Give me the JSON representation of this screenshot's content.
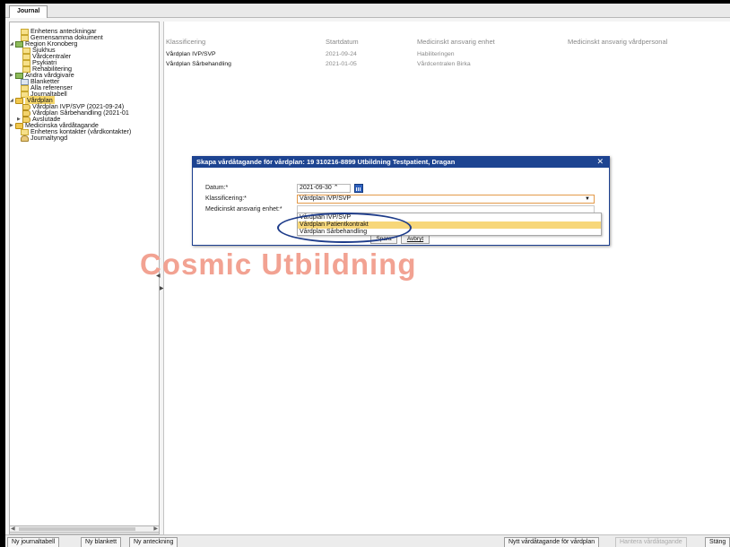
{
  "tabs": {
    "journal": "Journal"
  },
  "tree": [
    {
      "label": "Enhetens anteckningar",
      "icon": "document-icon"
    },
    {
      "label": "Gemensamma dokument",
      "icon": "document-icon"
    },
    {
      "label": "Region Kronoberg",
      "icon": "organization-icon"
    },
    {
      "label": "Sjukhus",
      "icon": "document-icon"
    },
    {
      "label": "Vårdcentraler",
      "icon": "document-icon"
    },
    {
      "label": "Psykiatri",
      "icon": "document-icon"
    },
    {
      "label": "Rehabilitering",
      "icon": "document-icon"
    },
    {
      "label": "Andra vårdgivare",
      "icon": "organization-icon"
    },
    {
      "label": "Blanketter",
      "icon": "table-icon"
    },
    {
      "label": "Alla referenser",
      "icon": "document-icon"
    },
    {
      "label": "Journaltabell",
      "icon": "document-icon"
    },
    {
      "label": "Vårdplan",
      "icon": "folder-icon"
    },
    {
      "label": "Vårdplan IVP/SVP (2021-09-24)",
      "icon": "care-plan-icon"
    },
    {
      "label": "Vårdplan Sårbehandling (2021-01",
      "icon": "care-plan-icon"
    },
    {
      "label": "Avslutade",
      "icon": "care-plan-icon"
    },
    {
      "label": "Medicinska vårdåtagande",
      "icon": "folder-icon"
    },
    {
      "label": "Enhetens kontakter (vårdkontakter)",
      "icon": "document-icon"
    },
    {
      "label": "Journaltyngd",
      "icon": "person-icon"
    }
  ],
  "grid": {
    "headers": [
      "Klassificering",
      "Startdatum",
      "Medicinskt ansvarig enhet",
      "Medicinskt ansvarig vårdpersonal"
    ],
    "rows": [
      [
        "Vårdplan IVP/SVP",
        "2021-09-24",
        "Habiliteringen",
        ""
      ],
      [
        "Vårdplan Sårbehandling",
        "2021-01-05",
        "Vårdcentralen Birka",
        ""
      ]
    ]
  },
  "dialog": {
    "title": "Skapa vårdåtagande för vårdplan: 19 310216-8899 Utbildning Testpatient, Dragan",
    "close": "✕",
    "date_label": "Datum:*",
    "date_value": "2021-09-30 ⌃",
    "class_label": "Klassificering:*",
    "class_value": "Vårdplan IVP/SVP",
    "enhet_label": "Medicinskt ansvarig enhet:*",
    "options": [
      "Vårdplan IVP/SVP",
      "Vårdplan Patientkontrakt",
      "Vårdplan Sårbehandling"
    ],
    "highlighted_option": 1,
    "save": "Spara",
    "cancel": "Avbryt"
  },
  "watermark": "Cosmic Utbildning",
  "bottom": {
    "new_table": "Ny journaltabell",
    "new_form": "Ny blankett",
    "new_note": "Ny anteckning",
    "new_commitment": "Nytt vårdåtagande för vårdplan",
    "handle_commitment": "Hantera vårdåtagande",
    "close": "Stäng"
  },
  "colors": {
    "dialog_title": "#1d4491",
    "highlight": "#f7d77a",
    "watermark": "#f2a292"
  }
}
